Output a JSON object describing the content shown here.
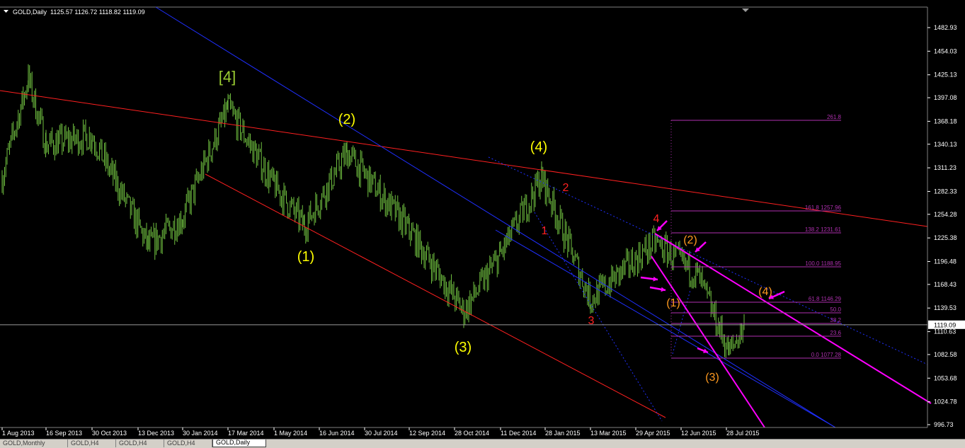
{
  "window": {
    "symbol_header": "GOLD,Daily  1125.57 1126.72 1118.82 1119.09",
    "current_price_label": "1119.09"
  },
  "colors": {
    "background": "#000000",
    "candles": "#6fbf3f",
    "price_axis_text": "#ffffff",
    "channel_red": "#ff2020",
    "channel_blue": "#1f2fff",
    "fib": "#b030b0",
    "magenta": "#ff00ff",
    "wave_yellow": "#ffff00",
    "wave_green": "#9acd32",
    "wave_red": "#ff2020",
    "wave_orange": "#ff9a1f"
  },
  "chart_data": {
    "type": "candlestick",
    "symbol": "GOLD",
    "timeframe": "Daily",
    "ohlc_last": {
      "open": 1125.57,
      "high": 1126.72,
      "low": 1118.82,
      "close": 1119.09
    },
    "y_ticks": [
      "1482.93",
      "1454.03",
      "1425.13",
      "1397.08",
      "1368.18",
      "1340.13",
      "1311.23",
      "1282.33",
      "1254.28",
      "1225.38",
      "1196.48",
      "1168.43",
      "1139.53",
      "1110.63",
      "1082.58",
      "1053.68",
      "1024.78",
      "996.73"
    ],
    "x_ticks": [
      "1 Aug 2013",
      "16 Sep 2013",
      "30 Oct 2013",
      "13 Dec 2013",
      "30 Jan 2014",
      "17 Mar 2014",
      "1 May 2014",
      "16 Jun 2014",
      "30 Jul 2014",
      "12 Sep 2014",
      "28 Oct 2014",
      "11 Dec 2014",
      "28 Jan 2015",
      "13 Mar 2015",
      "29 Apr 2015",
      "12 Jun 2015",
      "28 Jul 2015"
    ],
    "ylim": [
      990,
      1500
    ],
    "series_anchors": [
      {
        "x": "1 Aug 2013",
        "close": 1300
      },
      {
        "x": "28 Aug 2013",
        "close": 1420
      },
      {
        "x": "16 Sep 2013",
        "close": 1340
      },
      {
        "x": "30 Oct 2013",
        "close": 1350
      },
      {
        "x": "13 Dec 2013",
        "close": 1215
      },
      {
        "x": "30 Jan 2014",
        "close": 1250
      },
      {
        "x": "17 Mar 2014",
        "close": 1385
      },
      {
        "x": "1 May 2014",
        "close": 1290
      },
      {
        "x": "16 Jun 2014",
        "close": 1240
      },
      {
        "x": "30 Jul 2014",
        "close": 1330
      },
      {
        "x": "12 Sep 2014",
        "close": 1235
      },
      {
        "x": "28 Oct 2014",
        "close": 1135
      },
      {
        "x": "11 Dec 2014",
        "close": 1205
      },
      {
        "x": "28 Jan 2015",
        "close": 1300
      },
      {
        "x": "13 Mar 2015",
        "close": 1150
      },
      {
        "x": "29 Apr 2015",
        "close": 1220
      },
      {
        "x": "12 Jun 2015",
        "close": 1180
      },
      {
        "x": "28 Jul 2015",
        "close": 1085
      },
      {
        "x": "Aug 2015",
        "close": 1119.09
      }
    ],
    "fibonacci_levels": [
      {
        "label": "261.8"
      },
      {
        "label": "161.8  1257.96"
      },
      {
        "label": "138.2  1231.61"
      },
      {
        "label": "100.0  1188.95"
      },
      {
        "label": "61.8  1146.29"
      },
      {
        "label": "50.0"
      },
      {
        "label": "38.2"
      },
      {
        "label": "23.6"
      },
      {
        "label": "0.0  1077.28"
      }
    ],
    "wave_labels": [
      "[4]",
      "(1)",
      "(2)",
      "(3)",
      "(4)",
      "1",
      "2",
      "3",
      "4",
      "(1)",
      "(2)",
      "(3)",
      "(4)"
    ]
  },
  "tabs": [
    {
      "label": "GOLD,Monthly",
      "active": false
    },
    {
      "label": "GOLD,H4",
      "active": false
    },
    {
      "label": "GOLD,H4",
      "active": false
    },
    {
      "label": "GOLD,H4",
      "active": false
    },
    {
      "label": "GOLD,Daily",
      "active": true
    }
  ]
}
